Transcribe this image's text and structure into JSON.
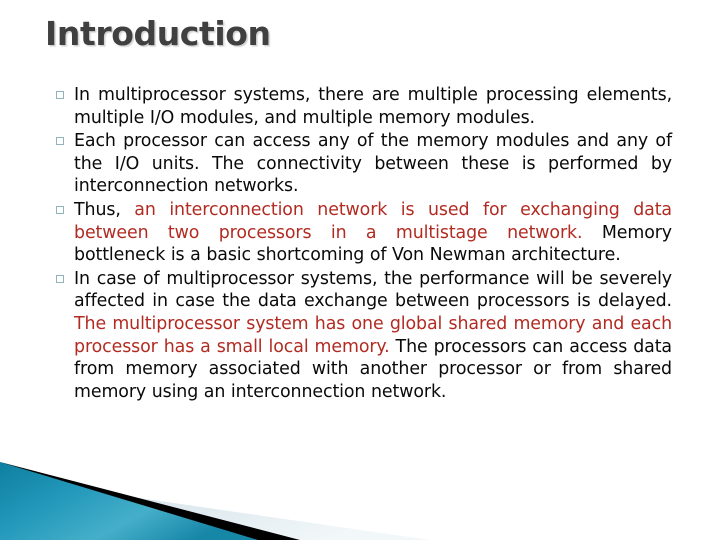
{
  "slide": {
    "title": "Introduction",
    "bullet_glyph": "square-outline",
    "colors": {
      "title": "#404040",
      "body_text": "#0A0A0A",
      "highlight_red": "#B22B22",
      "bullet_marker": "#8FB4BA",
      "decor_blue_light": "#4FAFC8",
      "decor_blue_dark": "#0C7C9C",
      "decor_pale": "#DCE7EC",
      "decor_black": "#000000",
      "background": "#FFFFFF"
    },
    "bullets": [
      {
        "id": "bullet-1",
        "segments": [
          {
            "text": "In multiprocessor systems, there are multiple processing elements, multiple I/O modules, and multiple memory modules.",
            "color": "black"
          }
        ]
      },
      {
        "id": "bullet-2",
        "segments": [
          {
            "text": "Each processor can access any of the memory modules and any of the I/O units. The connectivity between these is performed by interconnection networks.",
            "color": "black"
          }
        ]
      },
      {
        "id": "bullet-3",
        "segments": [
          {
            "text": "Thus, ",
            "color": "black"
          },
          {
            "text": "an interconnection network is used for exchanging data between two processors in a multistage network.",
            "color": "red"
          },
          {
            "text": " Memory bottleneck is a basic shortcoming of Von Newman architecture.",
            "color": "black"
          }
        ]
      },
      {
        "id": "bullet-4",
        "segments": [
          {
            "text": "In case of multiprocessor systems, the performance will be severely affected in case the data exchange between processors is delayed. ",
            "color": "black"
          },
          {
            "text": "The multiprocessor system has one global shared memory and each processor has a small local memory.",
            "color": "red"
          },
          {
            "text": " The processors can access data from memory associated with another processor or from shared memory using an interconnection network.",
            "color": "black"
          }
        ]
      }
    ]
  }
}
